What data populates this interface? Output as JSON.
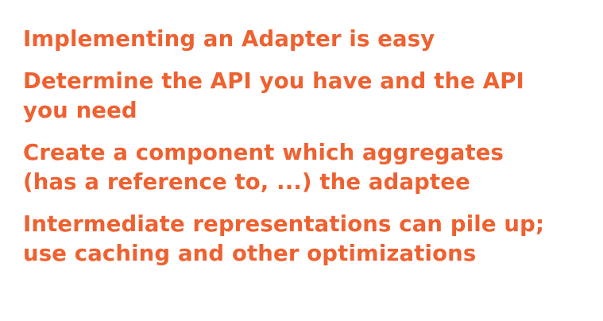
{
  "slide": {
    "accent_color": "#ee6130",
    "background_color": "#ffffff",
    "points": [
      {
        "lines": [
          "Implementing an Adapter is easy"
        ]
      },
      {
        "lines": [
          "Determine the API you have and the API",
          "you need"
        ]
      },
      {
        "lines": [
          "Create a component which aggregates",
          "(has a reference to, ...) the adaptee"
        ]
      },
      {
        "lines": [
          "Intermediate representations can pile up;",
          "use caching and other optimizations"
        ]
      }
    ]
  }
}
